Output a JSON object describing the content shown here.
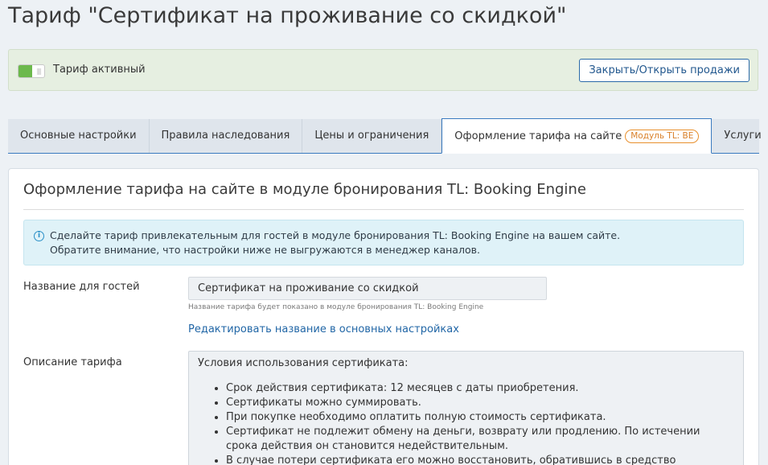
{
  "page": {
    "title": "Тариф \"Сертификат на проживание со скидкой\""
  },
  "status": {
    "label": "Тариф активный",
    "sales_button": "Закрыть/Открыть продажи",
    "active_color": "#6cb94c"
  },
  "tabs": [
    {
      "label": "Основные настройки"
    },
    {
      "label": "Правила наследования"
    },
    {
      "label": "Цены и ограничения"
    },
    {
      "label": "Оформление тарифа на сайте",
      "badge": "Модуль TL: BE",
      "active": true
    },
    {
      "label": "Услуги"
    }
  ],
  "panel": {
    "title": "Оформление тарифа на сайте в модуле бронирования TL: Booking Engine",
    "info": {
      "line1": "Сделайте тариф привлекательным для гостей в модуле бронирования TL: Booking Engine на вашем сайте.",
      "line2": "Обратите внимание, что настройки ниже не выгружаются в менеджер каналов."
    },
    "guest_name": {
      "label": "Название для гостей",
      "value": "Сертификат на проживание со скидкой",
      "hint": "Название тарифа будет показано в модуле бронирования TL: Booking Engine",
      "edit_link": "Редактировать название в основных настройках"
    },
    "description": {
      "label": "Описание тарифа",
      "heading": "Условия использования сертификата:",
      "items": [
        "Срок действия сертификата: 12 месяцев с даты приобретения.",
        "Сертификаты можно суммировать.",
        "При покупке необходимо оплатить полную стоимость сертификата.",
        "Сертификат не подлежит обмену на деньги, возврату или продлению. По истечении срока действия он становится недействительным.",
        "В случае потери сертификата его можно восстановить, обратившись в средство размещения."
      ]
    }
  }
}
